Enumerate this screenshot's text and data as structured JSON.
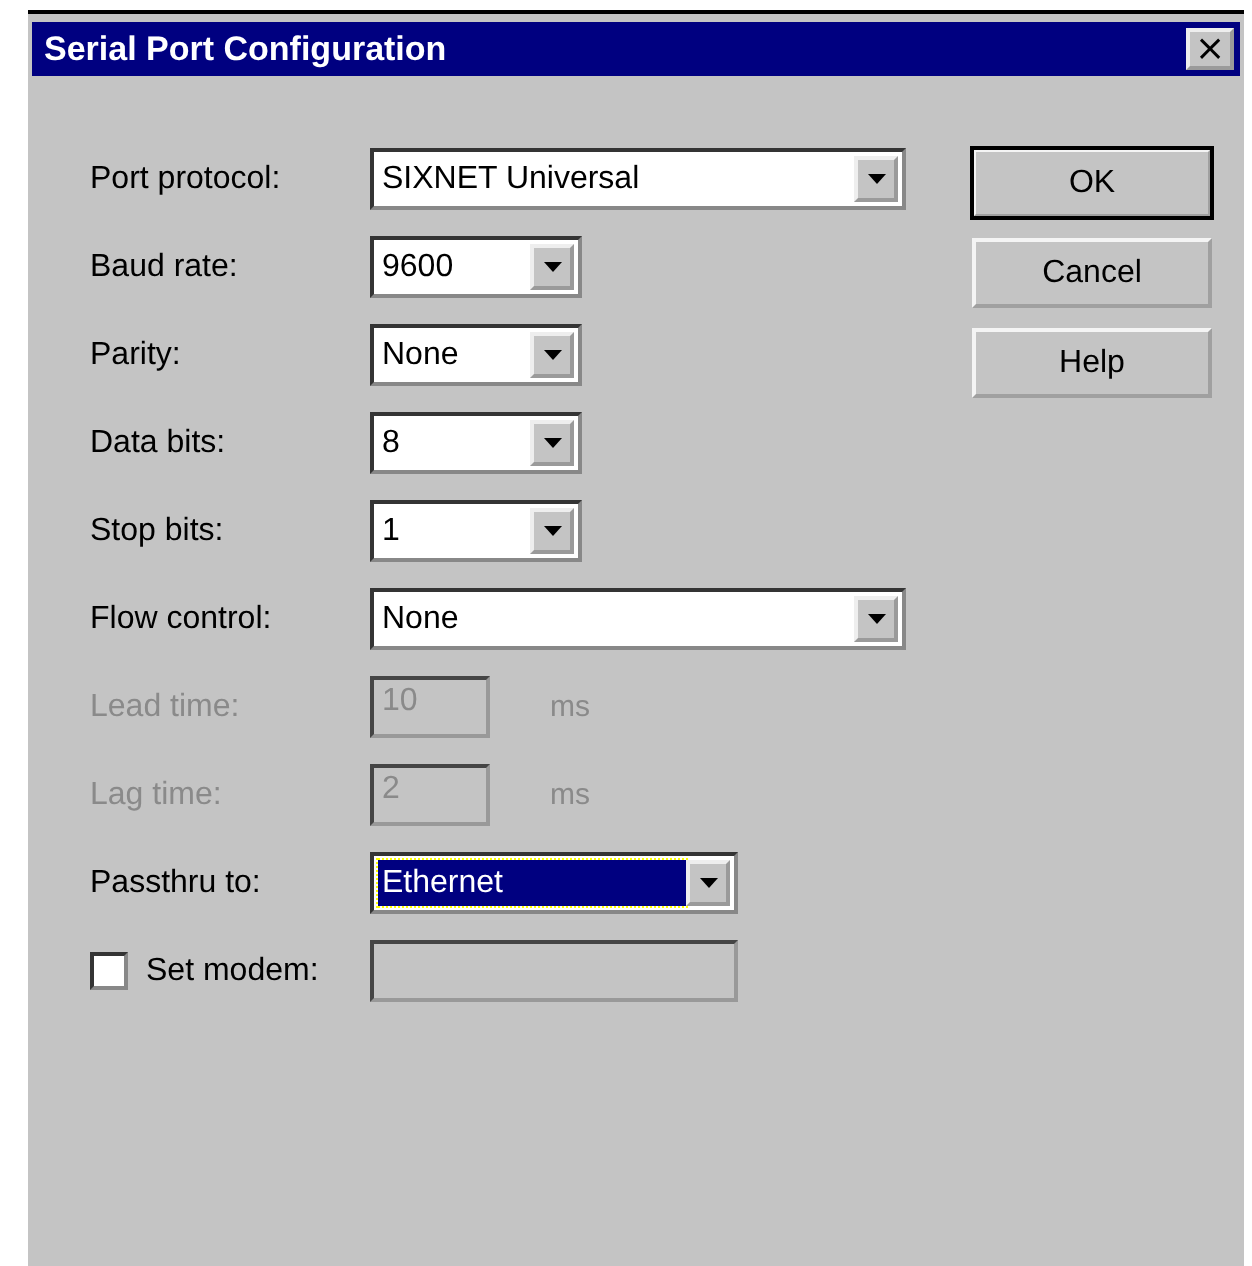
{
  "window": {
    "title": "Serial Port Configuration",
    "close_label": "×"
  },
  "fields": [
    {
      "kind": "dropdown",
      "label": "Port protocol:",
      "value": "SIXNET Universal",
      "focused": false,
      "disabled": false
    },
    {
      "kind": "dropdown",
      "label": "Baud rate:",
      "value": "9600",
      "focused": false,
      "disabled": false
    },
    {
      "kind": "dropdown",
      "label": "Parity:",
      "value": "None",
      "focused": false,
      "disabled": false
    },
    {
      "kind": "dropdown",
      "label": "Data bits:",
      "value": "8",
      "focused": false,
      "disabled": false
    },
    {
      "kind": "dropdown",
      "label": "Stop bits:",
      "value": "1",
      "focused": false,
      "disabled": false
    },
    {
      "kind": "dropdown",
      "label": "Flow control:",
      "value": "None",
      "focused": false,
      "disabled": false
    },
    {
      "kind": "number",
      "label": "Lead time:",
      "value": "10",
      "unit": "ms",
      "disabled": true
    },
    {
      "kind": "number",
      "label": "Lag time:",
      "value": "2",
      "unit": "ms",
      "disabled": true
    },
    {
      "kind": "dropdown",
      "label": "Passthru to:",
      "value": "Ethernet",
      "focused": true,
      "disabled": false
    },
    {
      "kind": "checkbox-field",
      "label": "Set modem:",
      "checked": false,
      "disabled": true
    }
  ],
  "buttons": [
    {
      "label": "OK",
      "default": true
    },
    {
      "label": "Cancel",
      "default": false
    },
    {
      "label": "Help",
      "default": false
    }
  ]
}
